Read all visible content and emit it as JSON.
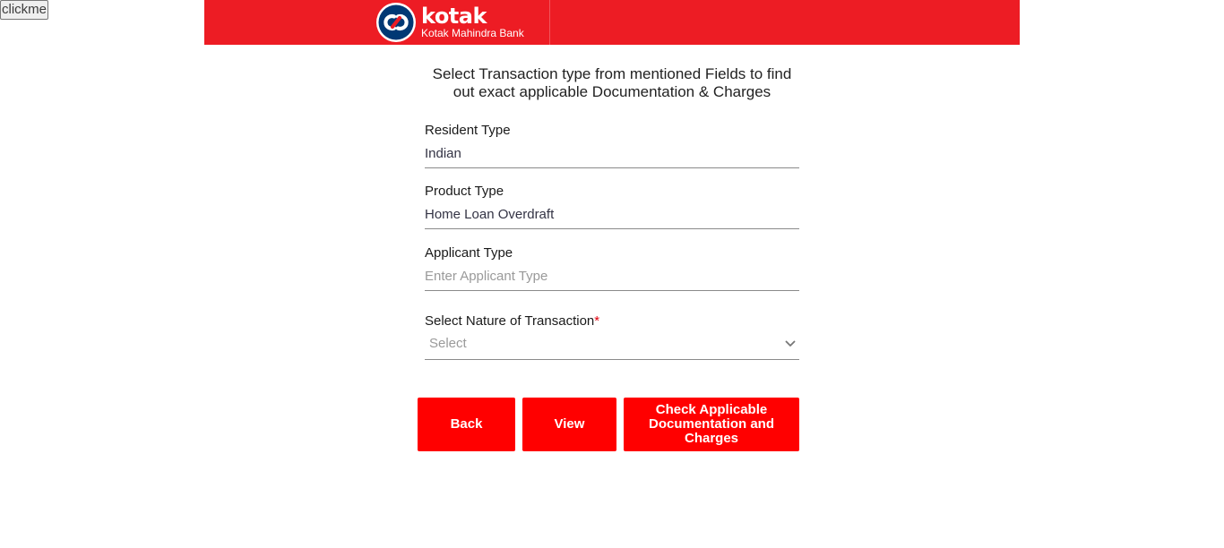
{
  "debug": {
    "clickme_label": "clickme"
  },
  "header": {
    "brand_word": "kotak",
    "brand_subtitle": "Kotak Mahindra Bank",
    "brand_color": "#ed1c24",
    "logo_icon": "kotak-infinity-logo-icon"
  },
  "intro": {
    "text": "Select Transaction type from mentioned Fields to find out exact applicable Documentation & Charges"
  },
  "form": {
    "resident_type": {
      "label": "Resident Type",
      "value": "Indian"
    },
    "product_type": {
      "label": "Product Type",
      "value": "Home Loan Overdraft"
    },
    "applicant_type": {
      "label": "Applicant Type",
      "value": "",
      "placeholder": "Enter Applicant Type"
    },
    "nature_of_transaction": {
      "label": "Select Nature of Transaction",
      "required_mark": "*",
      "selected": "Select",
      "icon": "chevron-down-icon"
    }
  },
  "actions": {
    "back_label": "Back",
    "view_label": "View",
    "check_label": "Check Applicable Documentation and Charges",
    "button_color": "#ff0000"
  }
}
